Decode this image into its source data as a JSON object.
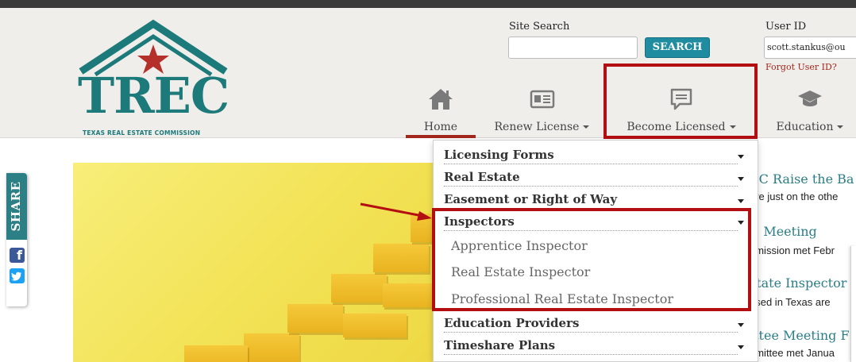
{
  "header": {
    "logo_text": "TREC",
    "logo_subtitle": "TEXAS REAL ESTATE COMMISSION",
    "search": {
      "label": "Site Search",
      "placeholder": "",
      "button": "SEARCH"
    },
    "user": {
      "label": "User ID",
      "value": "scott.stankus@ou",
      "forgot": "Forgot User ID?"
    }
  },
  "nav": {
    "items": [
      {
        "label": "Home",
        "icon": "home-icon",
        "active": true
      },
      {
        "label": "Renew License",
        "icon": "id-card-icon"
      },
      {
        "label": "Become Licensed",
        "icon": "chat-bubble-icon"
      },
      {
        "label": "Education",
        "icon": "graduation-cap-icon"
      }
    ]
  },
  "share": {
    "label": "SHARE",
    "facebook": "f"
  },
  "dropdown": {
    "rows": [
      {
        "label": "Licensing Forms"
      },
      {
        "label": "Real Estate"
      },
      {
        "label": "Easement or Right of Way"
      },
      {
        "label": "Inspectors"
      },
      {
        "label": "Education Providers"
      },
      {
        "label": "Timeshare Plans"
      }
    ],
    "inspectors_sub": [
      "Apprentice Inspector",
      "Real Estate Inspector",
      "Professional Real Estate Inspector"
    ]
  },
  "news": [
    {
      "title": "EC Raise the Ba",
      "snippet": "are just on the othe"
    },
    {
      "title": "C Meeting",
      "snippet": "nmission met Febr"
    },
    {
      "title": "state Inspector",
      "snippet": "used in Texas are"
    },
    {
      "title": "ittee Meeting F",
      "snippet": "nmittee met Janua"
    }
  ],
  "colors": {
    "brand_teal": "#1d7a7a",
    "search_button": "#1f8ca0",
    "highlight_red": "#b30e12",
    "home_underline": "#a3261c",
    "facebook": "#3b5998",
    "twitter": "#1da1f2"
  }
}
